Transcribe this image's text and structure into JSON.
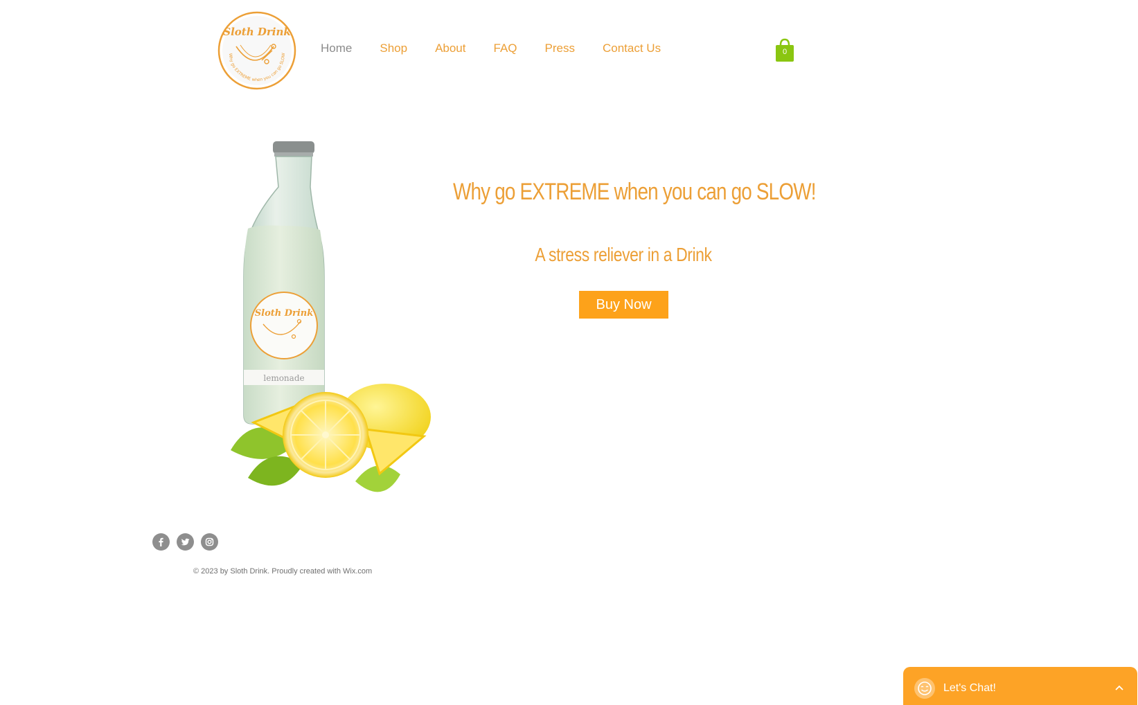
{
  "brand": {
    "logo_text": "Sloth Drink",
    "logo_ring_text": "Why go EXTREME when you can go SLOW!",
    "bottle_label": "lemonade",
    "accent_color": "#ec9f36",
    "button_color": "#fda21a",
    "cart_color": "#8ac611"
  },
  "nav": {
    "items": [
      {
        "label": "Home",
        "active": true
      },
      {
        "label": "Shop",
        "active": false
      },
      {
        "label": "About",
        "active": false
      },
      {
        "label": "FAQ",
        "active": false
      },
      {
        "label": "Press",
        "active": false
      },
      {
        "label": "Contact Us",
        "active": false
      }
    ]
  },
  "cart": {
    "count": "0",
    "icon": "shopping-bag-icon"
  },
  "hero": {
    "headline": "Why go EXTREME when you can go SLOW!",
    "subheadline": "A stress reliever in a Drink",
    "button_label": "Buy Now"
  },
  "footer": {
    "social": [
      {
        "name": "facebook",
        "icon": "facebook-icon"
      },
      {
        "name": "twitter",
        "icon": "twitter-icon"
      },
      {
        "name": "instagram",
        "icon": "instagram-icon"
      }
    ],
    "copyright": "© 2023 by Sloth Drink. Proudly created with Wix.com"
  },
  "chat": {
    "label": "Let's Chat!",
    "icon": "chat-smiley-icon",
    "toggle_icon": "chevron-up-icon"
  }
}
